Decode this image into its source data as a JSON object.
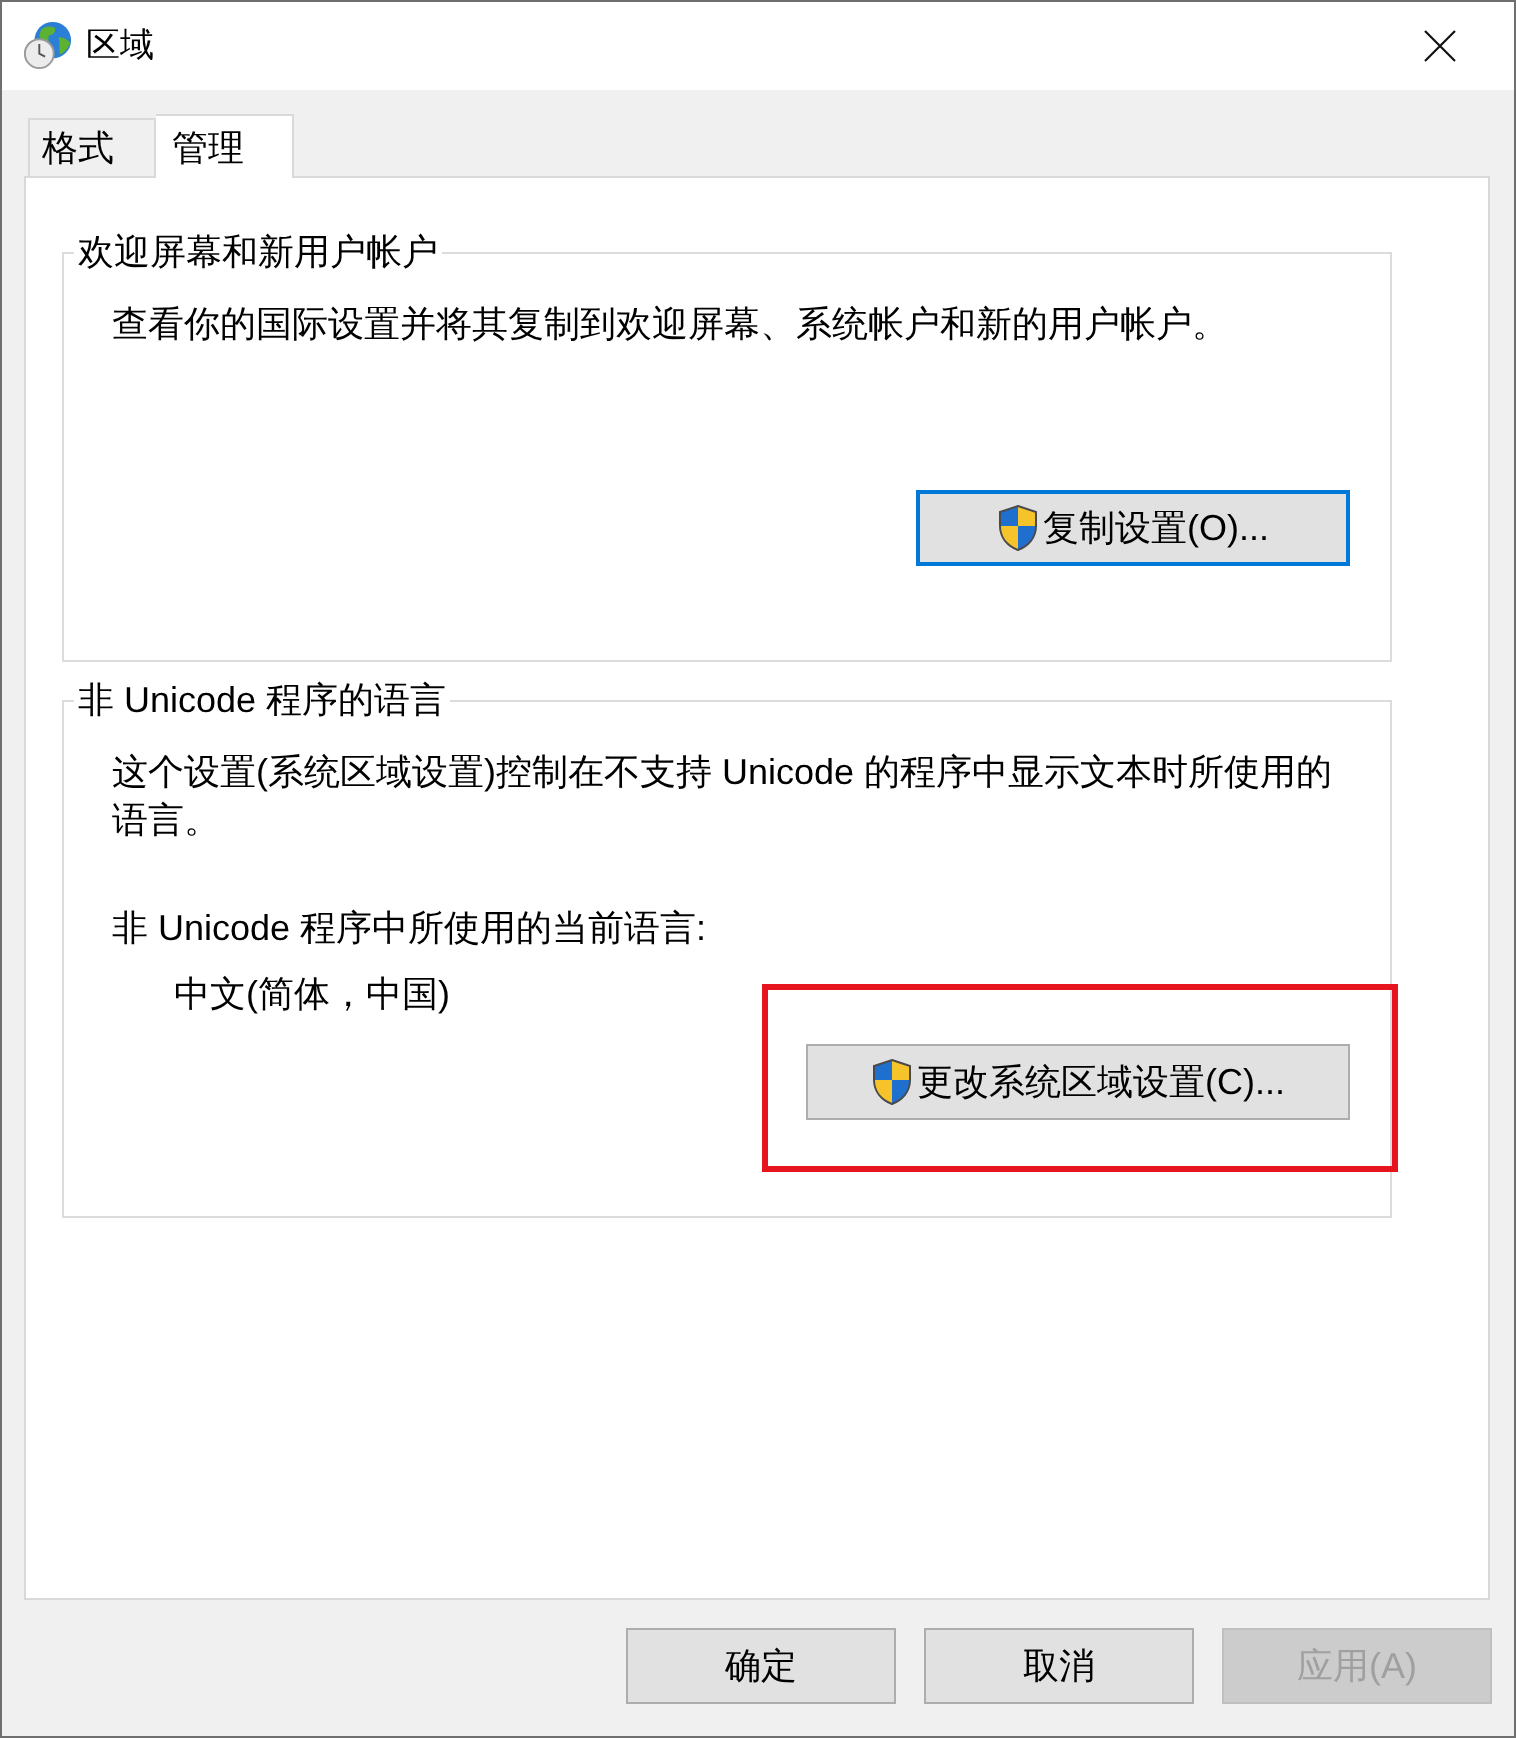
{
  "window": {
    "title": "区域"
  },
  "tabs": [
    {
      "label": "格式",
      "selected": false
    },
    {
      "label": "管理",
      "selected": true
    }
  ],
  "groups": [
    {
      "title": "欢迎屏幕和新用户帐户",
      "items": [
        {
          "kind": "text",
          "text": "查看你的国际设置并将其复制到欢迎屏幕、系统帐户和新的用户帐户。"
        },
        {
          "kind": "button",
          "label": "复制设置(O)...",
          "focused": true,
          "highlighted": false
        }
      ]
    },
    {
      "title": "非 Unicode 程序的语言",
      "items": [
        {
          "kind": "text",
          "text": "这个设置(系统区域设置)控制在不支持 Unicode 的程序中显示文本时所使用的语言。"
        },
        {
          "kind": "label",
          "text": "非 Unicode 程序中所使用的当前语言:"
        },
        {
          "kind": "value",
          "text": "中文(简体，中国)"
        },
        {
          "kind": "button",
          "label": "更改系统区域设置(C)...",
          "focused": false,
          "highlighted": true
        }
      ]
    }
  ],
  "buttons": [
    {
      "label": "确定",
      "disabled": false
    },
    {
      "label": "取消",
      "disabled": false
    },
    {
      "label": "应用(A)",
      "disabled": true
    }
  ]
}
